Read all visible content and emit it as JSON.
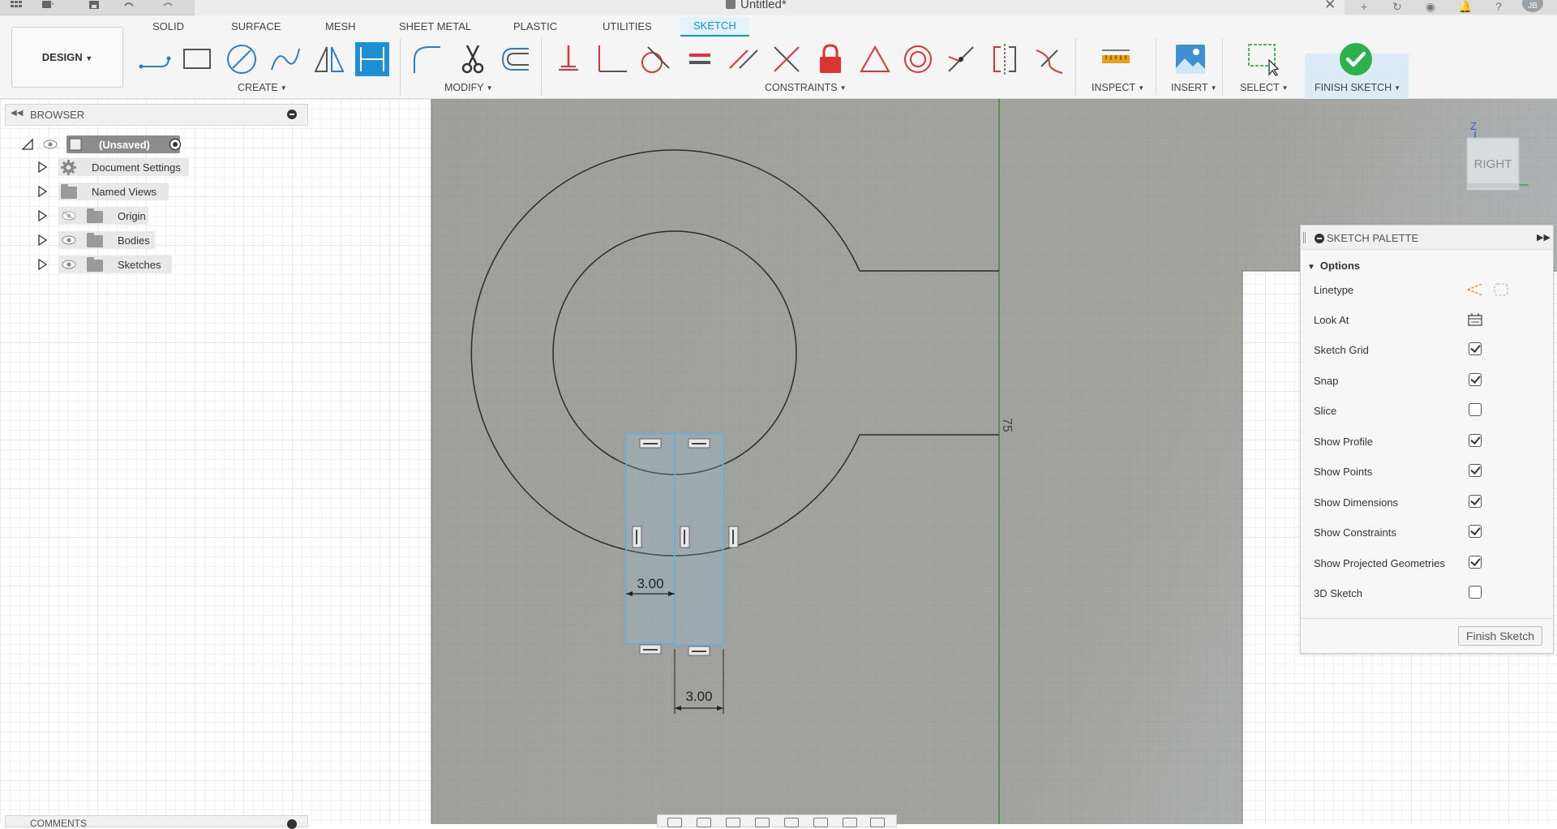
{
  "window": {
    "title": "Untitled*",
    "avatar_initials": "JB"
  },
  "toolbar": {
    "workspace_label": "DESIGN",
    "tabs": [
      {
        "label": "SOLID",
        "active": false
      },
      {
        "label": "SURFACE",
        "active": false
      },
      {
        "label": "MESH",
        "active": false
      },
      {
        "label": "SHEET METAL",
        "active": false
      },
      {
        "label": "PLASTIC",
        "active": false
      },
      {
        "label": "UTILITIES",
        "active": false
      },
      {
        "label": "SKETCH",
        "active": true
      }
    ],
    "groups": {
      "create": "CREATE",
      "modify": "MODIFY",
      "constraints": "CONSTRAINTS",
      "inspect": "INSPECT",
      "insert": "INSERT",
      "select": "SELECT",
      "finish_sketch": "FINISH SKETCH"
    },
    "accent_color": "#0696d7",
    "finish_color": "#2bb24c"
  },
  "browser": {
    "header": "BROWSER",
    "root": "(Unsaved)",
    "items": [
      {
        "label": "Document Settings",
        "icon": "gear-icon"
      },
      {
        "label": "Named Views",
        "icon": "folder-icon"
      },
      {
        "label": "Origin",
        "icon": "folder-icon",
        "hidden": true
      },
      {
        "label": "Bodies",
        "icon": "folder-icon"
      },
      {
        "label": "Sketches",
        "icon": "folder-icon"
      }
    ]
  },
  "canvas": {
    "dimension_1": "3.00",
    "dimension_2": "3.00",
    "vertical_label": "75",
    "viewcube_face": "RIGHT",
    "axis_z": "Z"
  },
  "sketch_palette": {
    "title": "SKETCH PALETTE",
    "section": "Options",
    "rows": [
      {
        "label": "Linetype",
        "kind": "icons"
      },
      {
        "label": "Look At",
        "kind": "icon"
      },
      {
        "label": "Sketch Grid",
        "kind": "checkbox",
        "checked": true
      },
      {
        "label": "Snap",
        "kind": "checkbox",
        "checked": true
      },
      {
        "label": "Slice",
        "kind": "checkbox",
        "checked": false
      },
      {
        "label": "Show Profile",
        "kind": "checkbox",
        "checked": true
      },
      {
        "label": "Show Points",
        "kind": "checkbox",
        "checked": true
      },
      {
        "label": "Show Dimensions",
        "kind": "checkbox",
        "checked": true
      },
      {
        "label": "Show Constraints",
        "kind": "checkbox",
        "checked": true
      },
      {
        "label": "Show Projected Geometries",
        "kind": "checkbox",
        "checked": true
      },
      {
        "label": "3D Sketch",
        "kind": "checkbox",
        "checked": false
      }
    ],
    "finish_button": "Finish Sketch"
  },
  "comments": {
    "label": "COMMENTS"
  }
}
